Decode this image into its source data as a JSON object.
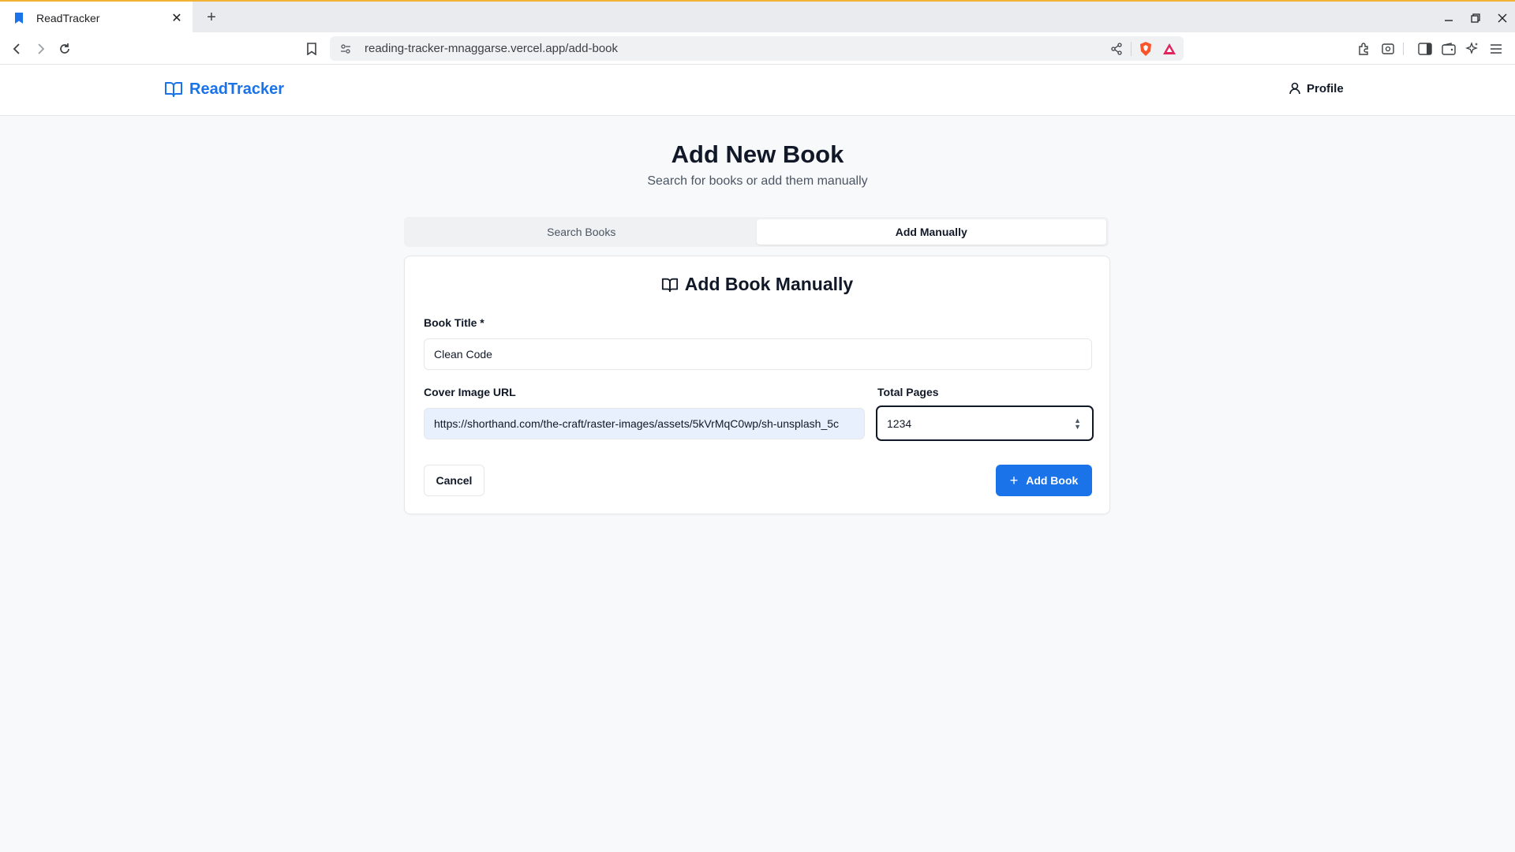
{
  "browser": {
    "tab_title": "ReadTracker",
    "url": "reading-tracker-mnaggarse.vercel.app/add-book"
  },
  "header": {
    "brand_name": "ReadTracker",
    "profile_label": "Profile"
  },
  "page": {
    "title": "Add New Book",
    "subtitle": "Search for books or add them manually"
  },
  "tabs": [
    {
      "label": "Search Books",
      "active": false
    },
    {
      "label": "Add Manually",
      "active": true
    }
  ],
  "form": {
    "heading": "Add Book Manually",
    "title_label": "Book Title *",
    "title_value": "Clean Code",
    "cover_label": "Cover Image URL",
    "cover_value": "https://shorthand.com/the-craft/raster-images/assets/5kVrMqC0wp/sh-unsplash_5c",
    "pages_label": "Total Pages",
    "pages_value": "1234",
    "cancel_label": "Cancel",
    "submit_label": "Add Book"
  },
  "colors": {
    "accent": "#1a73e8",
    "page_bg": "#f8f9fb",
    "autofill_bg": "#e8f0fe"
  },
  "icons": [
    "book-open-icon",
    "user-icon",
    "plus-icon",
    "bookmark-icon",
    "reload-icon",
    "back-icon",
    "forward-icon",
    "share-icon",
    "brave-shield-icon",
    "rewards-icon",
    "extensions-icon",
    "sidebar-icon",
    "wallet-icon",
    "leo-icon",
    "menu-icon"
  ]
}
